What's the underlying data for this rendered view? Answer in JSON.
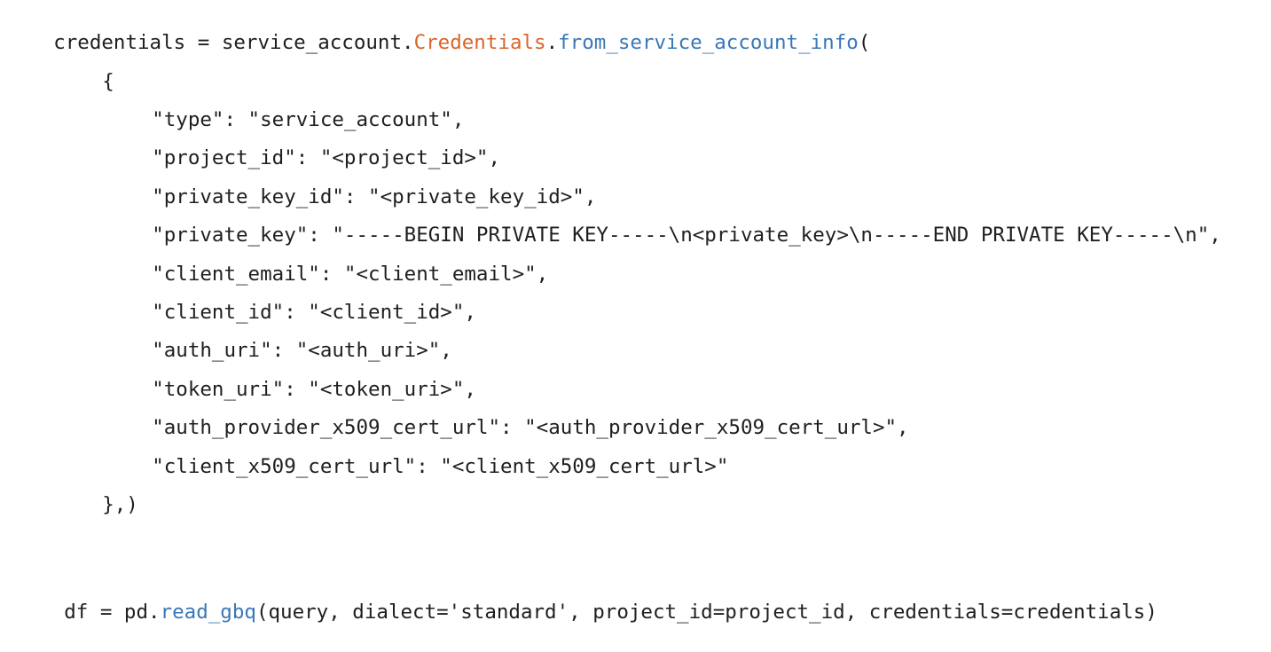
{
  "colors": {
    "text": "#1f1f1f",
    "class_name": "#d9652a",
    "function_name": "#3a78b6",
    "background": "#ffffff"
  },
  "code": {
    "lines": [
      {
        "tokens": [
          {
            "text": "credentials = service_account.",
            "kind": "plain"
          },
          {
            "text": "Credentials",
            "kind": "class"
          },
          {
            "text": ".",
            "kind": "plain"
          },
          {
            "text": "from_service_account_info",
            "kind": "func"
          },
          {
            "text": "(",
            "kind": "plain"
          }
        ]
      },
      {
        "tokens": [
          {
            "text": "{",
            "kind": "plain"
          }
        ]
      },
      {
        "tokens": [
          {
            "text": "\"type\": \"service_account\",",
            "kind": "plain"
          }
        ]
      },
      {
        "tokens": [
          {
            "text": "\"project_id\": \"<project_id>\",",
            "kind": "plain"
          }
        ]
      },
      {
        "tokens": [
          {
            "text": "\"private_key_id\": \"<private_key_id>\",",
            "kind": "plain"
          }
        ]
      },
      {
        "tokens": [
          {
            "text": "\"private_key\": \"-----BEGIN PRIVATE KEY-----\\n<private_key>\\n-----END PRIVATE KEY-----\\n\",",
            "kind": "plain"
          }
        ]
      },
      {
        "tokens": [
          {
            "text": "\"client_email\": \"<client_email>\",",
            "kind": "plain"
          }
        ]
      },
      {
        "tokens": [
          {
            "text": "\"client_id\": \"<client_id>\",",
            "kind": "plain"
          }
        ]
      },
      {
        "tokens": [
          {
            "text": "\"auth_uri\": \"<auth_uri>\",",
            "kind": "plain"
          }
        ]
      },
      {
        "tokens": [
          {
            "text": "\"token_uri\": \"<token_uri>\",",
            "kind": "plain"
          }
        ]
      },
      {
        "tokens": [
          {
            "text": "\"auth_provider_x509_cert_url\": \"<auth_provider_x509_cert_url>\",",
            "kind": "plain"
          }
        ]
      },
      {
        "tokens": [
          {
            "text": "\"client_x509_cert_url\": \"<client_x509_cert_url>\"",
            "kind": "plain"
          }
        ]
      },
      {
        "tokens": [
          {
            "text": "},)",
            "kind": "plain"
          }
        ]
      },
      {
        "tokens": [
          {
            "text": "df = pd.",
            "kind": "plain"
          },
          {
            "text": "read_gbq",
            "kind": "func"
          },
          {
            "text": "(query, dialect='standard', project_id=project_id, credentials=credentials)",
            "kind": "plain"
          }
        ]
      }
    ]
  }
}
